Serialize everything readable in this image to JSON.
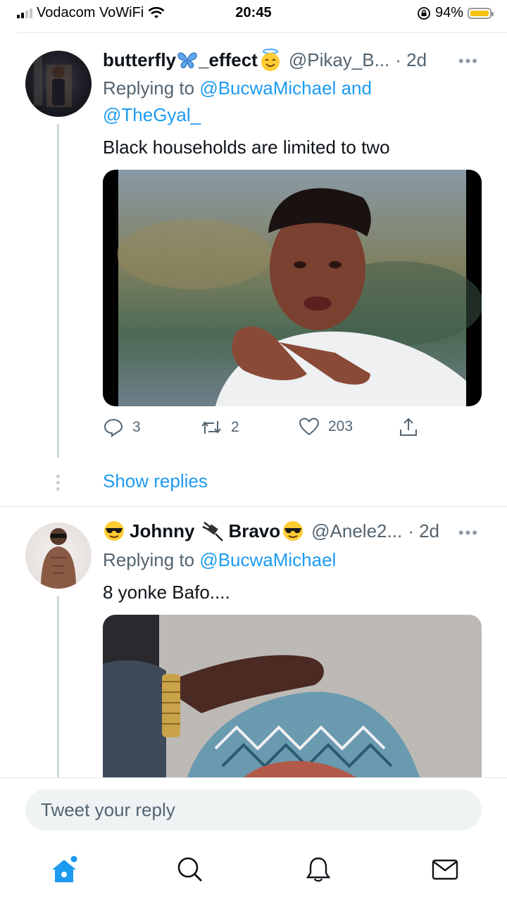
{
  "status_bar": {
    "carrier": "Vodacom VoWiFi",
    "time": "20:45",
    "battery": "94%"
  },
  "tweets": [
    {
      "name": "butterfly",
      "name_suffix": "_effect",
      "handle": "@Pikay_B...",
      "time": "· 2d",
      "more": "•••",
      "replying_prefix": "Replying to",
      "replying_to_1": "@BucwaMichael",
      "replying_and": "and",
      "replying_to_2": "@TheGyal_",
      "text": "Black households are limited to two",
      "replies": "3",
      "retweets": "2",
      "likes": "203",
      "show_replies": "Show replies"
    },
    {
      "name_1": "Johnny",
      "name_2": "Bravo",
      "handle": "@Anele2...",
      "time": "· 2d",
      "more": "•••",
      "replying_prefix": "Replying to",
      "replying_to_1": "@BucwaMichael",
      "text": "8 yonke Bafo...."
    }
  ],
  "compose": {
    "placeholder": "Tweet your reply"
  },
  "icons": {
    "wifi": "wifi-icon",
    "lock_rotation": "orientation-lock-icon",
    "reply": "reply-icon",
    "retweet": "retweet-icon",
    "like": "heart-icon",
    "share": "share-icon",
    "home": "home-icon",
    "search": "search-icon",
    "notifications": "bell-icon",
    "messages": "mail-icon"
  },
  "colors": {
    "accent": "#1d9bf0",
    "secondary_text": "#536471",
    "battery": "#f4c20d"
  }
}
